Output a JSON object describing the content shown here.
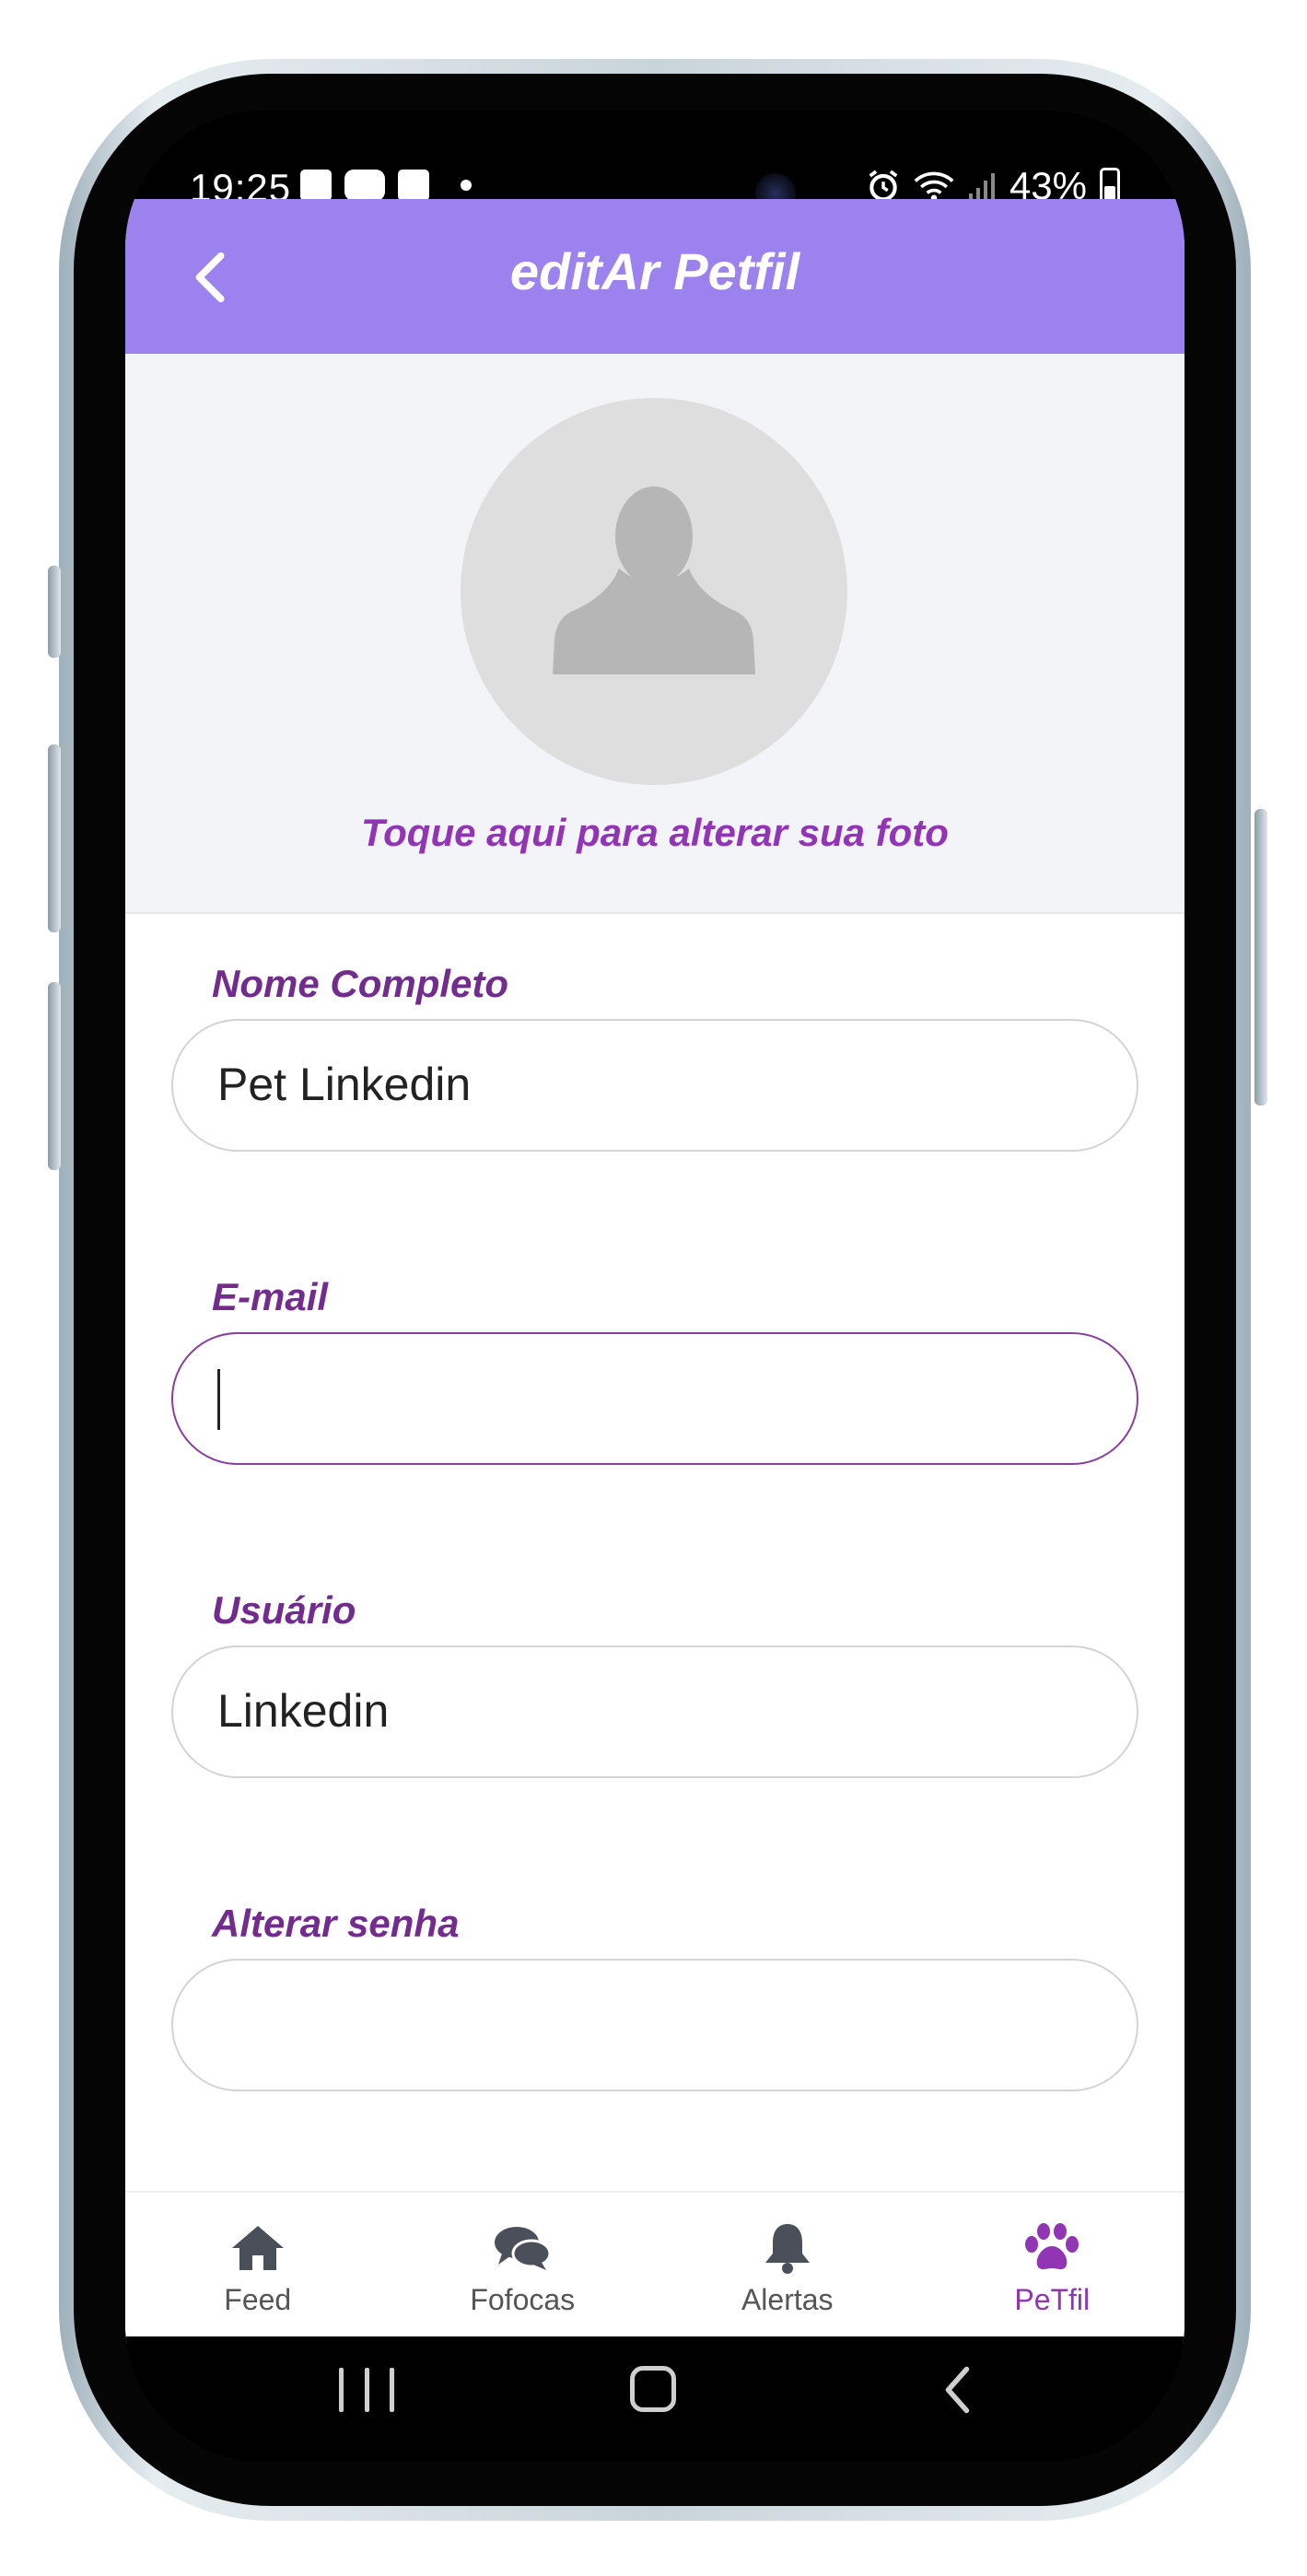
{
  "status_bar": {
    "time": "19:25",
    "battery": "43%"
  },
  "header": {
    "title": "editAr Petfil",
    "back_icon": "chevron-left-icon"
  },
  "photo": {
    "hint": "Toque aqui para alterar sua foto",
    "avatar_icon": "person-silhouette-icon"
  },
  "form": {
    "name_label": "Nome Completo",
    "name_value": "Pet Linkedin",
    "email_label": "E-mail",
    "email_value": "",
    "user_label": "Usuário",
    "user_value": "Linkedin",
    "password_label": "Alterar senha",
    "password_value": ""
  },
  "tabs": [
    {
      "label": "Feed",
      "icon": "home-icon"
    },
    {
      "label": "Fofocas",
      "icon": "chat-bubbles-icon"
    },
    {
      "label": "Alertas",
      "icon": "bell-icon"
    },
    {
      "label": "PeTfil",
      "icon": "paw-icon",
      "active": true
    }
  ],
  "colors": {
    "header": "#9b82ee",
    "accent": "#9135b5",
    "label": "#722c8e",
    "tab_inactive": "#555555"
  }
}
